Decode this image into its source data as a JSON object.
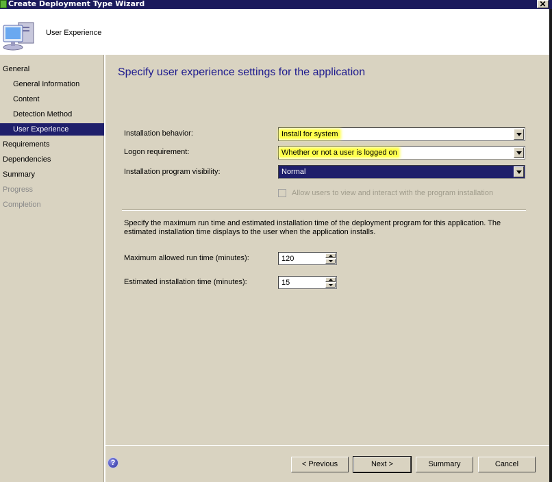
{
  "window": {
    "title": "Create Deployment Type Wizard",
    "close_glyph": "✕"
  },
  "header": {
    "title": "User Experience",
    "icon": "computer-icon"
  },
  "sidebar": {
    "items": [
      {
        "label": "General",
        "level": 0,
        "state": "normal"
      },
      {
        "label": "General Information",
        "level": 1,
        "state": "normal"
      },
      {
        "label": "Content",
        "level": 1,
        "state": "normal"
      },
      {
        "label": "Detection Method",
        "level": 1,
        "state": "normal"
      },
      {
        "label": "User Experience",
        "level": 1,
        "state": "selected"
      },
      {
        "label": "Requirements",
        "level": 0,
        "state": "normal"
      },
      {
        "label": "Dependencies",
        "level": 0,
        "state": "normal"
      },
      {
        "label": "Summary",
        "level": 0,
        "state": "normal"
      },
      {
        "label": "Progress",
        "level": 0,
        "state": "disabled"
      },
      {
        "label": "Completion",
        "level": 0,
        "state": "disabled"
      }
    ]
  },
  "main": {
    "title": "Specify user experience settings for the application",
    "installation_behavior": {
      "label": "Installation behavior:",
      "value": "Install for system"
    },
    "logon_requirement": {
      "label": "Logon requirement:",
      "value": "Whether or not a user is logged on"
    },
    "program_visibility": {
      "label": "Installation program visibility:",
      "value": "Normal"
    },
    "allow_interact": {
      "label": "Allow users to view and interact with the program installation",
      "checked": false,
      "enabled": false
    },
    "description": "Specify the maximum run time and estimated installation time of the deployment program for this application. The estimated installation time displays to the user when the application installs.",
    "max_run_time": {
      "label": "Maximum allowed run time (minutes):",
      "value": "120"
    },
    "est_install_time": {
      "label": "Estimated installation time (minutes):",
      "value": "15"
    }
  },
  "footer": {
    "help_glyph": "?",
    "previous": "< Previous",
    "next": "Next >",
    "summary": "Summary",
    "cancel": "Cancel"
  },
  "colors": {
    "titlebar": "#1b1a5c",
    "selection": "#1f1f6b",
    "heading": "#1e1b8e",
    "highlight": "#ffff4d",
    "background": "#d9d3c1"
  }
}
